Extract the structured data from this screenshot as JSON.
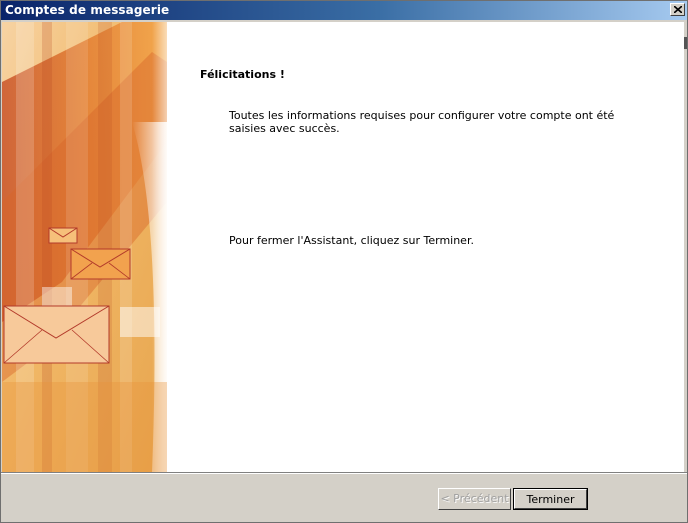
{
  "window": {
    "title": "Comptes de messagerie",
    "close_icon": "close-icon"
  },
  "main": {
    "heading": "Félicitations !",
    "paragraph1": "Toutes les informations requises pour configurer votre compte ont été saisies avec succès.",
    "paragraph2": "Pour fermer l'Assistant, cliquez sur Terminer."
  },
  "buttons": {
    "back_label": "< Précédent",
    "finish_label": "Terminer"
  },
  "colors": {
    "titlebar_start": "#0a246a",
    "titlebar_end": "#a6caf0",
    "dialog_bg": "#d4d0c8",
    "banner_orange": "#e8913a"
  }
}
